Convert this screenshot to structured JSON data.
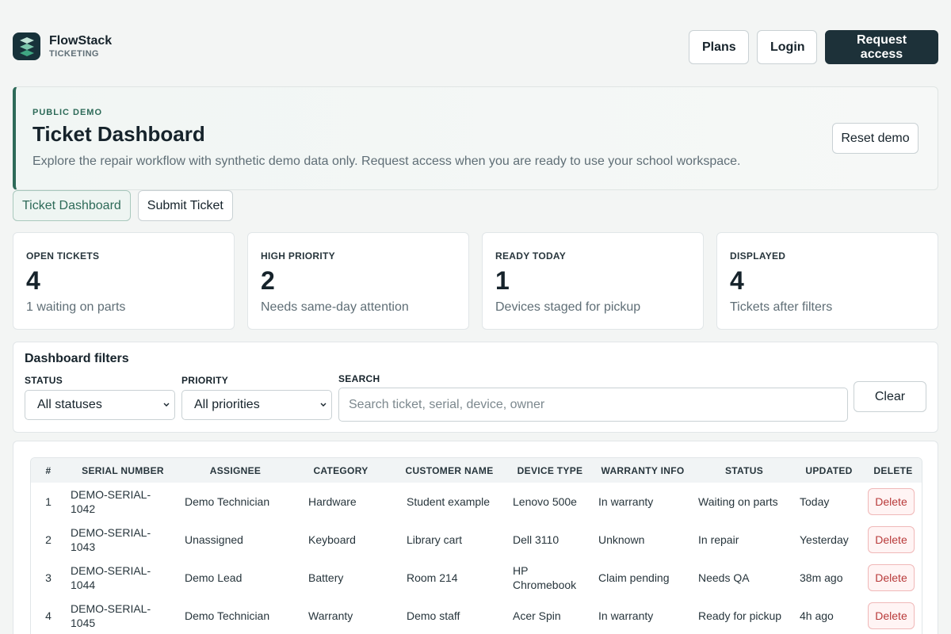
{
  "header": {
    "brand_name": "FlowStack",
    "brand_sub": "TICKETING",
    "plans_label": "Plans",
    "login_label": "Login",
    "request_label": "Request access"
  },
  "hero": {
    "tag": "PUBLIC DEMO",
    "title": "Ticket Dashboard",
    "description": "Explore the repair workflow with synthetic demo data only. Request access when you are ready to use your school workspace.",
    "reset_label": "Reset demo"
  },
  "tabs": [
    {
      "label": "Ticket Dashboard",
      "active": true
    },
    {
      "label": "Submit Ticket",
      "active": false
    }
  ],
  "stats": [
    {
      "label": "OPEN TICKETS",
      "value": "4",
      "note": "1 waiting on parts"
    },
    {
      "label": "HIGH PRIORITY",
      "value": "2",
      "note": "Needs same-day attention"
    },
    {
      "label": "READY TODAY",
      "value": "1",
      "note": "Devices staged for pickup"
    },
    {
      "label": "DISPLAYED",
      "value": "4",
      "note": "Tickets after filters"
    }
  ],
  "filters": {
    "title": "Dashboard filters",
    "status_label": "STATUS",
    "status_value": "All statuses",
    "priority_label": "PRIORITY",
    "priority_value": "All priorities",
    "search_label": "SEARCH",
    "search_placeholder": "Search ticket, serial, device, owner",
    "clear_label": "Clear"
  },
  "table": {
    "columns": [
      "#",
      "SERIAL NUMBER",
      "ASSIGNEE",
      "CATEGORY",
      "CUSTOMER NAME",
      "DEVICE TYPE",
      "WARRANTY INFO",
      "STATUS",
      "UPDATED",
      "DELETE"
    ],
    "delete_label": "Delete",
    "rows": [
      [
        "1",
        "DEMO-SERIAL-1042",
        "Demo Technician",
        "Hardware",
        "Student example",
        "Lenovo 500e",
        "In warranty",
        "Waiting on parts",
        "Today"
      ],
      [
        "2",
        "DEMO-SERIAL-1043",
        "Unassigned",
        "Keyboard",
        "Library cart",
        "Dell 3110",
        "Unknown",
        "In repair",
        "Yesterday"
      ],
      [
        "3",
        "DEMO-SERIAL-1044",
        "Demo Lead",
        "Battery",
        "Room 214",
        "HP Chromebook",
        "Claim pending",
        "Needs QA",
        "38m ago"
      ],
      [
        "4",
        "DEMO-SERIAL-1045",
        "Demo Technician",
        "Warranty",
        "Demo staff",
        "Acer Spin",
        "In warranty",
        "Ready for pickup",
        "4h ago"
      ]
    ]
  },
  "colors": {
    "brand_dark": "#1d3139",
    "accent_green": "#2d6a58",
    "delete_red": "#b83a3a"
  }
}
